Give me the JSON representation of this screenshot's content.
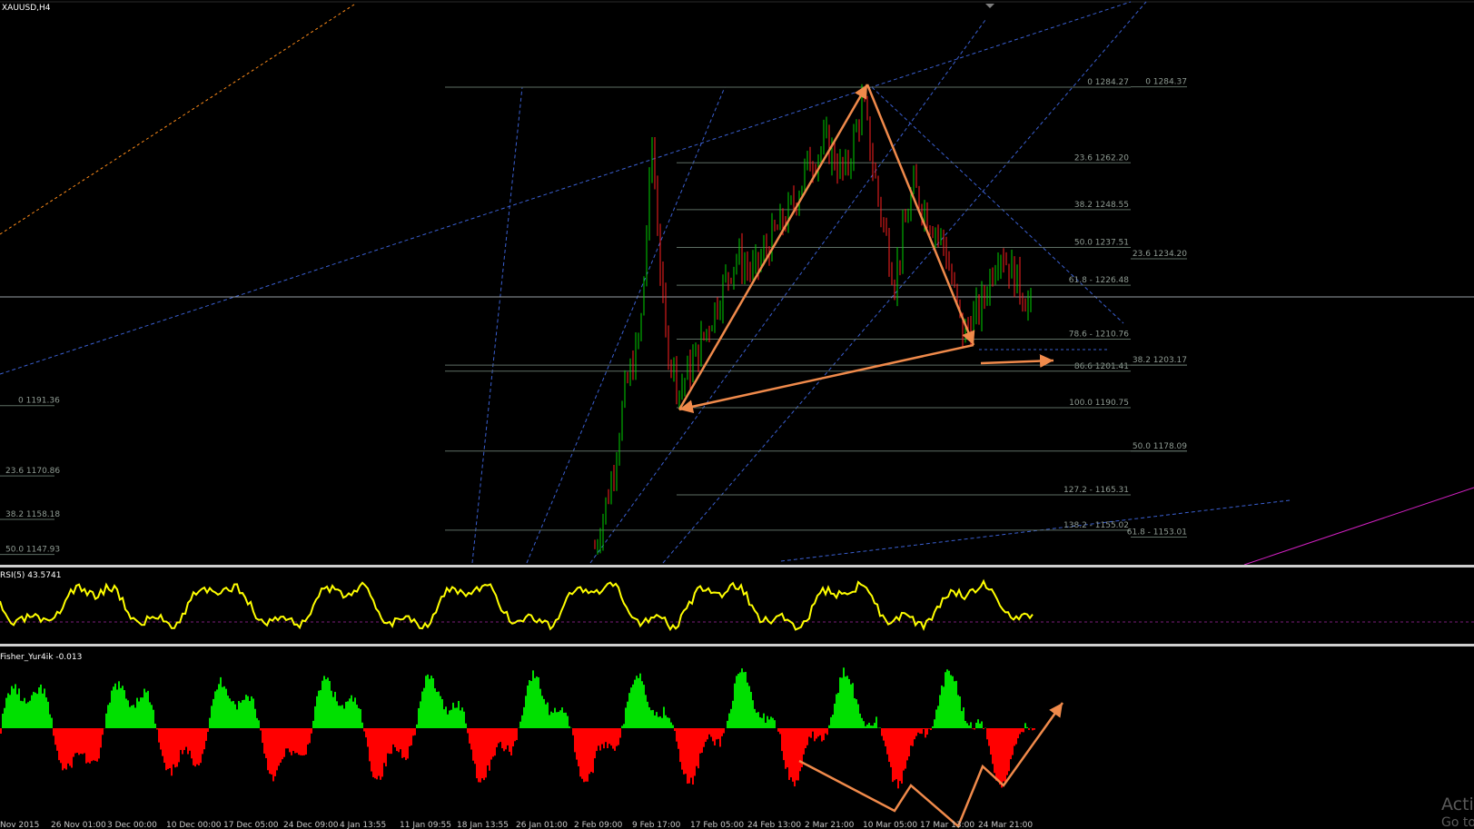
{
  "window": {
    "symbol_label": "XAUUSD,H4"
  },
  "colors": {
    "background": "#000000",
    "fib_line": "#5e6e64",
    "fib_text": "#8f9b93",
    "trend_blue": "#3a5fd0",
    "trend_orange": "#ff8c1a",
    "pattern_orange": "#f08a4b",
    "rsi_line": "#ffff00",
    "fisher_up": "#00e000",
    "fisher_down": "#ff0000",
    "candle_up": "#00d000",
    "candle_down": "#ff2020",
    "magenta": "#d020c0"
  },
  "main_chart": {
    "fib_labels_left": [
      {
        "text": "0 1191.36",
        "price": 1191.36
      },
      {
        "text": "23.6 1170.86",
        "price": 1170.86
      },
      {
        "text": "38.2 1158.18",
        "price": 1158.18
      },
      {
        "text": "50.0 1147.93",
        "price": 1147.93
      }
    ],
    "fib_labels_center": [
      {
        "text": "0 1284.27",
        "price": 1284.27
      },
      {
        "text": "23.6 1262.20",
        "price": 1262.2
      },
      {
        "text": "38.2 1248.55",
        "price": 1248.55
      },
      {
        "text": "50.0 1237.51",
        "price": 1237.51
      },
      {
        "text": "61.8 - 1226.48",
        "price": 1226.48
      },
      {
        "text": "78.6 - 1210.76",
        "price": 1210.76
      },
      {
        "text": "86.6 1201.41",
        "price": 1201.41
      },
      {
        "text": "100.0 1190.75",
        "price": 1190.75
      },
      {
        "text": "127.2 - 1165.31",
        "price": 1165.31
      },
      {
        "text": "138.2 - 1155.02",
        "price": 1155.02
      }
    ],
    "fib_labels_right": [
      {
        "text": "0 1284.37",
        "price": 1284.37
      },
      {
        "text": "23.6 1234.20",
        "price": 1234.2
      },
      {
        "text": "38.2 1203.17",
        "price": 1203.17
      },
      {
        "text": "50.0 1178.09",
        "price": 1178.09
      },
      {
        "text": "61.8 - 1153.01",
        "price": 1153.01
      }
    ]
  },
  "rsi_panel": {
    "label": "RSI(5) 43.5741"
  },
  "fisher_panel": {
    "label": "Fisher_Yur4ik -0.013"
  },
  "time_axis": [
    "Nov 2015",
    "26 Nov 01:00",
    "3 Dec 00:00",
    "10 Dec 00:00",
    "17 Dec 05:00",
    "24 Dec 09:00",
    "4 Jan 13:55",
    "11 Jan 09:55",
    "18 Jan 13:55",
    "26 Jan 01:00",
    "2 Feb 09:00",
    "9 Feb 17:00",
    "17 Feb 05:00",
    "24 Feb 13:00",
    "2 Mar 21:00",
    "10 Mar 05:00",
    "17 Mar 13:00",
    "24 Mar 21:00"
  ],
  "watermark": {
    "line1": "Activ",
    "line2": "Go to"
  }
}
